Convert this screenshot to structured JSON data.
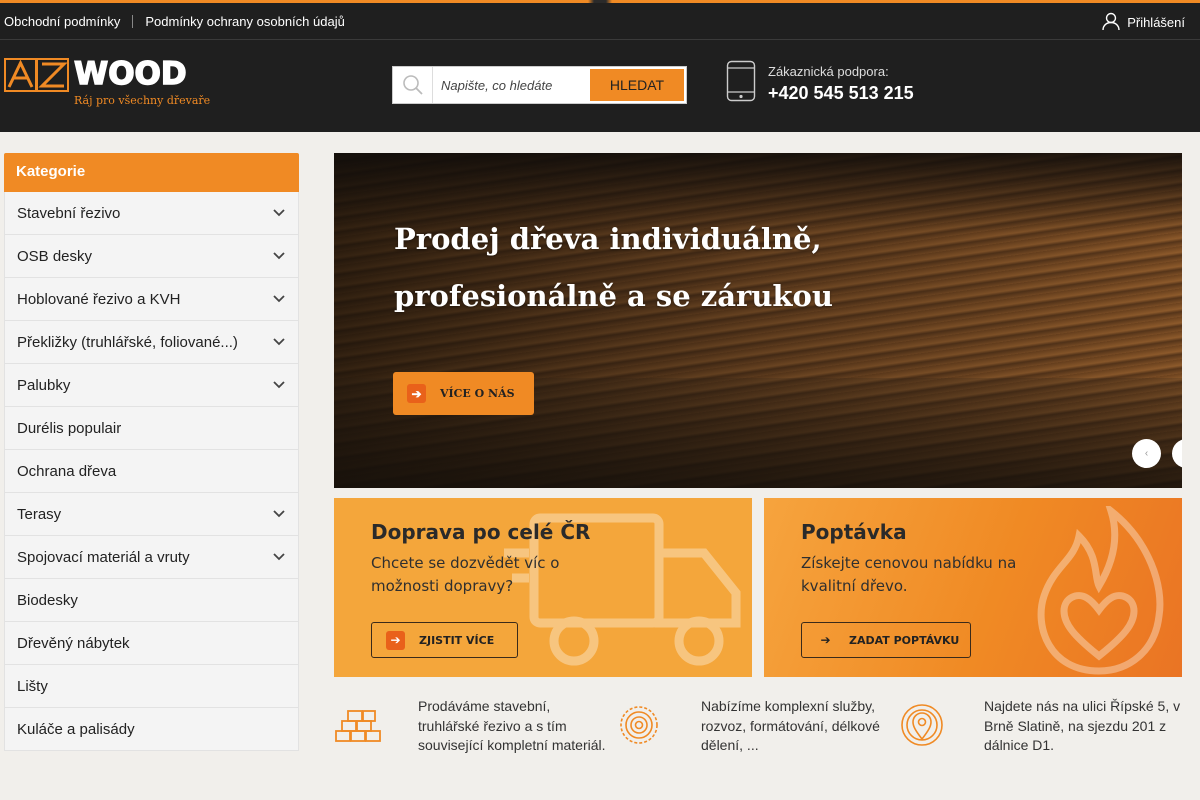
{
  "topbar": {
    "links": [
      "Obchodní podmínky",
      "Podmínky ochrany osobních údajů"
    ],
    "login_label": "Přihlášení"
  },
  "header": {
    "logo": {
      "mark": "AZ",
      "name": "WOOD",
      "tagline": "Ráj pro všechny dřevaře"
    },
    "search": {
      "placeholder": "Napište, co hledáte",
      "button_label": "HLEDAT"
    },
    "support": {
      "label": "Zákaznická podpora:",
      "phone": "+420 545 513 215"
    }
  },
  "sidebar": {
    "title": "Kategorie",
    "items": [
      {
        "label": "Stavební řezivo",
        "has_submenu": true
      },
      {
        "label": "OSB desky",
        "has_submenu": true
      },
      {
        "label": "Hoblované řezivo a KVH",
        "has_submenu": true
      },
      {
        "label": "Překližky (truhlářské, foliované...)",
        "has_submenu": true
      },
      {
        "label": "Palubky",
        "has_submenu": true
      },
      {
        "label": "Durélis populair",
        "has_submenu": false
      },
      {
        "label": "Ochrana dřeva",
        "has_submenu": false
      },
      {
        "label": "Terasy",
        "has_submenu": true
      },
      {
        "label": "Spojovací materiál a vruty",
        "has_submenu": true
      },
      {
        "label": "Biodesky",
        "has_submenu": false
      },
      {
        "label": "Dřevěný nábytek",
        "has_submenu": false
      },
      {
        "label": "Lišty",
        "has_submenu": false
      },
      {
        "label": "Kuláče a palisády",
        "has_submenu": false
      }
    ]
  },
  "banner": {
    "headline_line1": "Prodej dřeva individuálně,",
    "headline_line2": "profesionálně a se zárukou",
    "cta_label": "VÍCE O NÁS"
  },
  "promos": [
    {
      "title": "Doprava po celé ČR",
      "text": "Chcete se dozvědět víc o možnosti dopravy?",
      "button": "ZJISTIT VÍCE"
    },
    {
      "title": "Poptávka",
      "text": "Získejte cenovou nabídku na kvalitní dřevo.",
      "button": "ZADAT POPTÁVKU"
    }
  ],
  "features": [
    {
      "icon": "lumber-stack-icon",
      "text": "Prodáváme stavební, truhlářské řezivo a s tím související kompletní materiál."
    },
    {
      "icon": "tree-rings-icon",
      "text": "Nabízíme komplexní služby, rozvoz, formátování, délkové dělení, ..."
    },
    {
      "icon": "location-pin-icon",
      "text": "Najdete nás na ulici Řípské 5, v Brně Slatině, na sjezdu 201 z dálnice D1."
    }
  ],
  "colors": {
    "accent": "#f08a24",
    "dark": "#1f1f1f",
    "page_bg": "#f1efeb"
  }
}
